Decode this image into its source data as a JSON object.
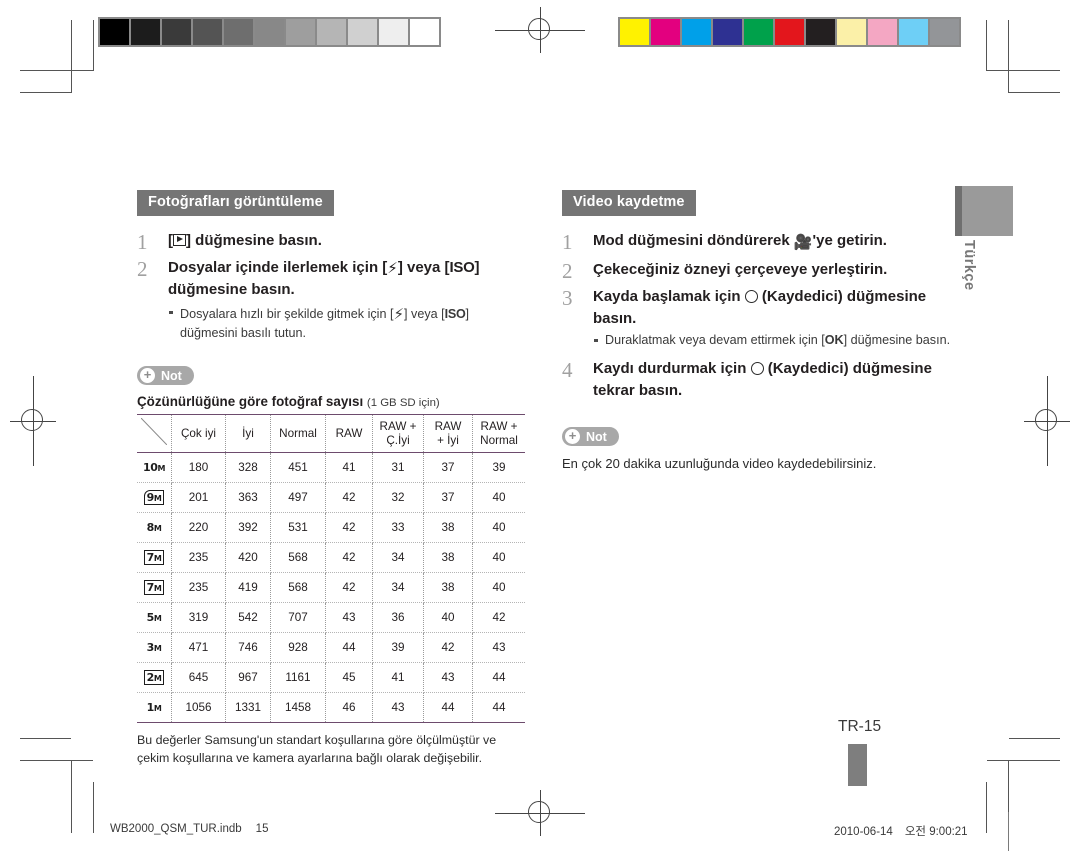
{
  "print_marks": {
    "grayscale_swatches": [
      "#000000",
      "#1c1c1c",
      "#3a3a3a",
      "#545454",
      "#6e6e6e",
      "#888888",
      "#9e9e9e",
      "#b5b5b5",
      "#d0d0d0",
      "#eeeeee",
      "#ffffff"
    ],
    "color_swatches": [
      "#fff200",
      "#e3007f",
      "#00a0e9",
      "#2e3192",
      "#00a14b",
      "#e3161c",
      "#231f20",
      "#fbf0a8",
      "#f4a7c3",
      "#6ecff6",
      "#939598"
    ]
  },
  "left_column": {
    "section_title": "Fotoğrafları görüntüleme",
    "steps": [
      {
        "num": "1",
        "prefix": "[",
        "key": "play-icon",
        "text": "] düğmesine basın."
      },
      {
        "num": "2",
        "text_a": "Dosyalar içinde ilerlemek için [",
        "key_a": "⚡",
        "text_b": "] veya [",
        "key_b": "ISO",
        "text_c": "] düğmesine basın.",
        "sub_a": "Dosyalara hızlı bir şekilde gitmek için [",
        "sub_b": "] veya [",
        "sub_key_b": "ISO",
        "sub_c": "] düğmesini basılı tutun."
      }
    ],
    "not_label": "Not",
    "table_caption": "Çözünürlüğüne göre fotoğraf sayısı",
    "table_caption_sub": "(1 GB SD için)",
    "table_note": "Bu değerler Samsung'un standart koşullarına göre ölçülmüştür ve çekim koşullarına ve kamera ayarlarına bağlı olarak değişebilir."
  },
  "chart_data": {
    "type": "table",
    "title": "Çözünürlüğüne göre fotoğraf sayısı (1 GB SD için)",
    "columns": [
      "",
      "Çok iyi",
      "İyi",
      "Normal",
      "RAW",
      "RAW + Ç.İyi",
      "RAW + İyi",
      "RAW + Normal"
    ],
    "column_labels_wrapped": [
      {
        "l1": "",
        "l2": ""
      },
      {
        "l1": "Çok iyi",
        "l2": ""
      },
      {
        "l1": "İyi",
        "l2": ""
      },
      {
        "l1": "Normal",
        "l2": ""
      },
      {
        "l1": "RAW",
        "l2": ""
      },
      {
        "l1": "RAW +",
        "l2": "Ç.İyi"
      },
      {
        "l1": "RAW",
        "l2": "+ İyi"
      },
      {
        "l1": "RAW +",
        "l2": "Normal"
      }
    ],
    "rows": [
      {
        "resolution": "10M",
        "style": "plain",
        "values": [
          180,
          328,
          451,
          41,
          31,
          37,
          39
        ]
      },
      {
        "resolution": "9M",
        "style": "wide",
        "values": [
          201,
          363,
          497,
          42,
          32,
          37,
          40
        ]
      },
      {
        "resolution": "8M",
        "style": "plain",
        "values": [
          220,
          392,
          531,
          42,
          33,
          38,
          40
        ]
      },
      {
        "resolution": "7M",
        "style": "boxed",
        "values": [
          235,
          420,
          568,
          42,
          34,
          38,
          40
        ]
      },
      {
        "resolution": "7M",
        "style": "boxed",
        "values": [
          235,
          419,
          568,
          42,
          34,
          38,
          40
        ]
      },
      {
        "resolution": "5M",
        "style": "plain",
        "values": [
          319,
          542,
          707,
          43,
          36,
          40,
          42
        ]
      },
      {
        "resolution": "3M",
        "style": "plain",
        "values": [
          471,
          746,
          928,
          44,
          39,
          42,
          43
        ]
      },
      {
        "resolution": "2M",
        "style": "boxed",
        "values": [
          645,
          967,
          1161,
          45,
          41,
          43,
          44
        ]
      },
      {
        "resolution": "1M",
        "style": "plain",
        "values": [
          1056,
          1331,
          1458,
          46,
          43,
          44,
          44
        ]
      }
    ]
  },
  "right_column": {
    "section_title": "Video kaydetme",
    "steps": [
      {
        "num": "1",
        "text_a": "Mod düğmesini döndürerek ",
        "key": "🎥",
        "text_b": "'ye getirin."
      },
      {
        "num": "2",
        "text_a": "Çekeceğiniz özneyi çerçeveye yerleştirin."
      },
      {
        "num": "3",
        "text_a": "Kayda başlamak için ",
        "key": "record-circle",
        "text_b": " (Kaydedici) düğmesine basın.",
        "sub_a": "Duraklatmak veya devam ettirmek için [",
        "sub_key": "OK",
        "sub_b": "] düğmesine basın."
      },
      {
        "num": "4",
        "text_a": "Kaydı durdurmak için ",
        "key": "record-circle",
        "text_b": " (Kaydedici) düğmesine tekrar basın."
      }
    ],
    "not_label": "Not",
    "note_text": "En çok 20 dakika uzunluğunda video kaydedebilirsiniz."
  },
  "side_tab": {
    "label": "Türkçe"
  },
  "page_number": "TR-15",
  "footer": {
    "filename": "WB2000_QSM_TUR.indb",
    "page": "15",
    "date": "2010-06-14",
    "ampm": "오전",
    "time": "9:00:21"
  }
}
